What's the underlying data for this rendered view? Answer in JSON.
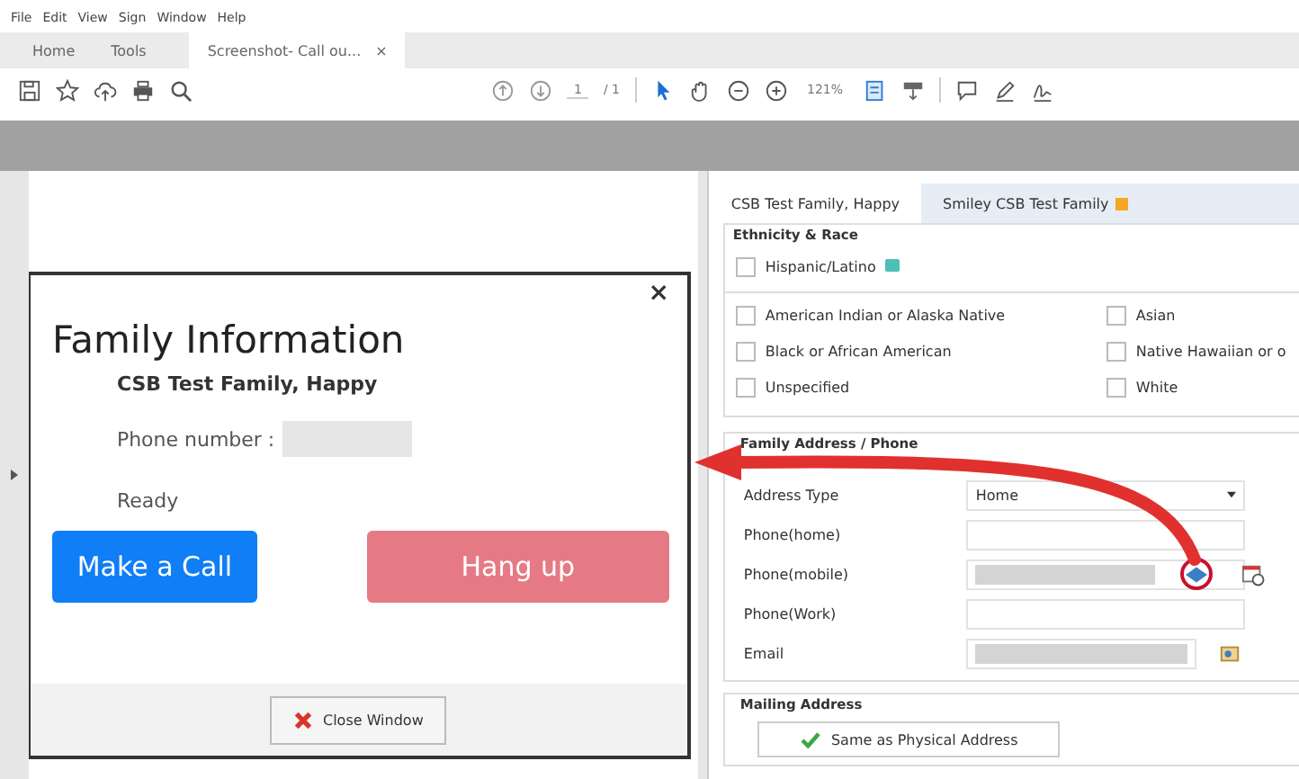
{
  "menu_bar": [
    "File",
    "Edit",
    "View",
    "Sign",
    "Window",
    "Help"
  ],
  "app_tabs": [
    {
      "label": "Home",
      "selected": false
    },
    {
      "label": "Tools",
      "selected": false
    },
    {
      "label": "Screenshot- Call ou...",
      "selected": true,
      "close": "×"
    }
  ],
  "toolbar": {
    "page": "1",
    "page_count": "/ 1",
    "zoom": "121%"
  },
  "dialog": {
    "close": "×",
    "title": "Family Information",
    "family_name": "CSB Test Family, Happy",
    "phone_label": "Phone number :",
    "status": "Ready",
    "close_button": "Close Window",
    "buttons": [
      {
        "label": "Make a Call",
        "kind": "primary"
      },
      {
        "label": "Hang up",
        "kind": "danger"
      }
    ]
  },
  "record_tabs": [
    {
      "label": "CSB Test Family, Happy",
      "selected": true,
      "flag": false
    },
    {
      "label": "Smiley  CSB Test Family",
      "selected": false,
      "flag": true
    }
  ],
  "ethnicity": {
    "heading": "Ethnicity & Race",
    "hispanic": {
      "label": "Hispanic/Latino",
      "checked": false
    },
    "races": [
      {
        "label": "American Indian or Alaska Native",
        "checked": false
      },
      {
        "label": "Asian",
        "checked": false
      },
      {
        "label": "Black or African American",
        "checked": false
      },
      {
        "label": "Native Hawaiian or o",
        "checked": false
      },
      {
        "label": "Unspecified",
        "checked": false
      },
      {
        "label": "White",
        "checked": false
      }
    ]
  },
  "family_address": {
    "heading": "Family Address / Phone",
    "rows": [
      {
        "label": "Address Type",
        "kind": "select",
        "value": "Home"
      },
      {
        "label": "Phone(home)",
        "kind": "text"
      },
      {
        "label": "Phone(mobile)",
        "kind": "call"
      },
      {
        "label": "Phone(Work)",
        "kind": "text"
      },
      {
        "label": "Email",
        "kind": "mail"
      }
    ]
  },
  "mailing_address": {
    "heading": "Mailing Address",
    "button": "Same as Physical Address"
  }
}
